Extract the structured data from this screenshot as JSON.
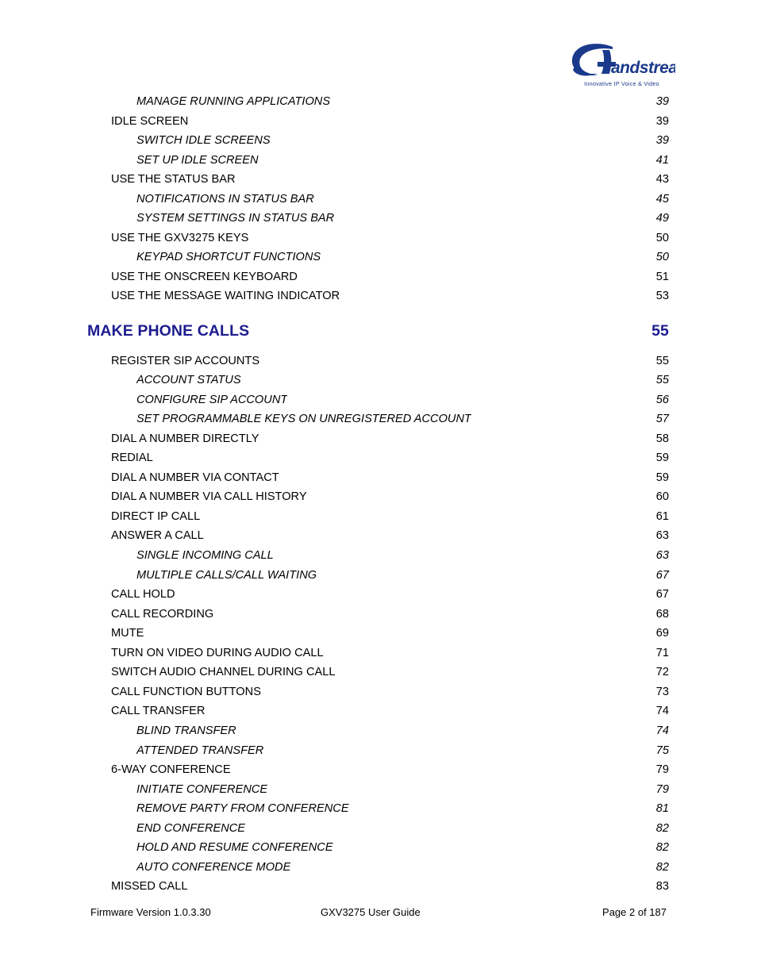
{
  "logo": {
    "brand": "Grandstream",
    "tagline": "Innovative IP Voice & Video",
    "brand_color": "#1b3a8c"
  },
  "document": {
    "heading_color": "#1c1c8f"
  },
  "toc": {
    "entries": [
      {
        "level": 2,
        "label": "MANAGE RUNNING APPLICATIONS",
        "page": "39"
      },
      {
        "level": 1,
        "label": "IDLE SCREEN",
        "page": "39"
      },
      {
        "level": 2,
        "label": "SWITCH IDLE SCREENS",
        "page": "39"
      },
      {
        "level": 2,
        "label": "SET UP IDLE SCREEN",
        "page": "41"
      },
      {
        "level": 1,
        "label": "USE THE STATUS BAR",
        "page": "43"
      },
      {
        "level": 2,
        "label": "NOTIFICATIONS IN STATUS BAR",
        "page": "45"
      },
      {
        "level": 2,
        "label": "SYSTEM SETTINGS IN STATUS BAR",
        "page": "49"
      },
      {
        "level": 1,
        "label": "USE THE GXV3275 KEYS",
        "page": "50"
      },
      {
        "level": 2,
        "label": "KEYPAD SHORTCUT FUNCTIONS",
        "page": "50"
      },
      {
        "level": 1,
        "label": "USE THE ONSCREEN KEYBOARD",
        "page": "51"
      },
      {
        "level": 1,
        "label": "USE THE MESSAGE WAITING INDICATOR",
        "page": "53"
      },
      {
        "level": 0,
        "label": "MAKE PHONE CALLS",
        "page": "55"
      },
      {
        "level": 1,
        "label": "REGISTER SIP ACCOUNTS",
        "page": "55"
      },
      {
        "level": 2,
        "label": "ACCOUNT STATUS",
        "page": "55"
      },
      {
        "level": 2,
        "label": "CONFIGURE SIP ACCOUNT",
        "page": "56"
      },
      {
        "level": 2,
        "label": "SET PROGRAMMABLE KEYS ON UNREGISTERED ACCOUNT",
        "page": "57"
      },
      {
        "level": 1,
        "label": "DIAL A NUMBER DIRECTLY",
        "page": "58"
      },
      {
        "level": 1,
        "label": "REDIAL",
        "page": "59"
      },
      {
        "level": 1,
        "label": "DIAL A NUMBER VIA CONTACT",
        "page": "59"
      },
      {
        "level": 1,
        "label": "DIAL A NUMBER VIA CALL HISTORY",
        "page": "60"
      },
      {
        "level": 1,
        "label": "DIRECT IP CALL",
        "page": "61"
      },
      {
        "level": 1,
        "label": "ANSWER A CALL",
        "page": "63"
      },
      {
        "level": 2,
        "label": "SINGLE INCOMING CALL",
        "page": "63"
      },
      {
        "level": 2,
        "label": "MULTIPLE CALLS/CALL WAITING",
        "page": "67"
      },
      {
        "level": 1,
        "label": "CALL HOLD",
        "page": "67"
      },
      {
        "level": 1,
        "label": "CALL RECORDING",
        "page": "68"
      },
      {
        "level": 1,
        "label": "MUTE",
        "page": "69"
      },
      {
        "level": 1,
        "label": "TURN ON VIDEO DURING AUDIO CALL",
        "page": "71"
      },
      {
        "level": 1,
        "label": "SWITCH AUDIO CHANNEL DURING CALL",
        "page": "72"
      },
      {
        "level": 1,
        "label": "CALL FUNCTION BUTTONS",
        "page": "73"
      },
      {
        "level": 1,
        "label": "CALL TRANSFER",
        "page": "74"
      },
      {
        "level": 2,
        "label": "BLIND TRANSFER",
        "page": "74"
      },
      {
        "level": 2,
        "label": "ATTENDED TRANSFER",
        "page": "75"
      },
      {
        "level": 1,
        "label": "6-WAY CONFERENCE",
        "page": "79"
      },
      {
        "level": 2,
        "label": "INITIATE CONFERENCE",
        "page": "79"
      },
      {
        "level": 2,
        "label": "REMOVE PARTY FROM CONFERENCE",
        "page": "81"
      },
      {
        "level": 2,
        "label": "END CONFERENCE",
        "page": "82"
      },
      {
        "level": 2,
        "label": "HOLD AND RESUME CONFERENCE",
        "page": "82"
      },
      {
        "level": 2,
        "label": "AUTO CONFERENCE MODE",
        "page": "82"
      },
      {
        "level": 1,
        "label": "MISSED CALL",
        "page": "83"
      }
    ]
  },
  "footer": {
    "firmware": "Firmware Version 1.0.3.30",
    "title": "GXV3275 User Guide",
    "page": "Page 2 of 187"
  }
}
